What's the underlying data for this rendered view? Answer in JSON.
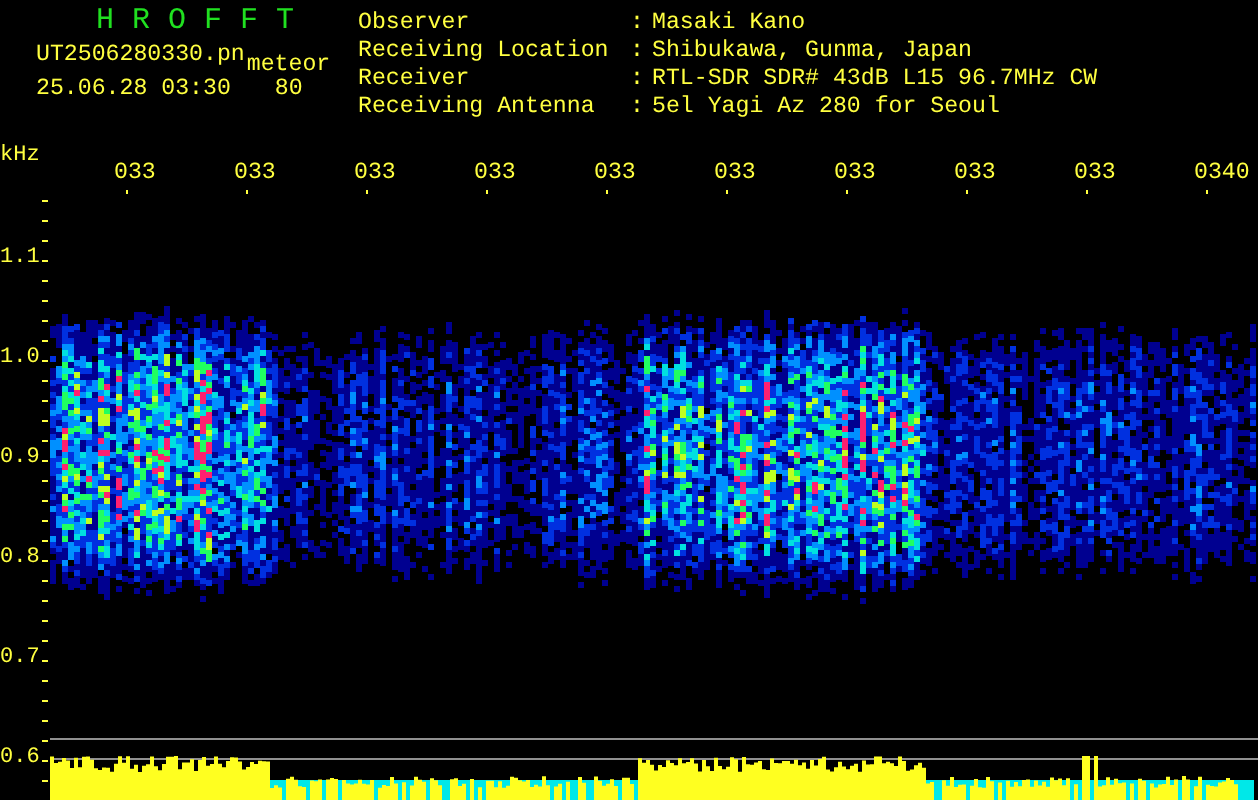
{
  "header": {
    "title": "H R O F F T",
    "filename": "UT2506280330.pn",
    "mode": "meteor",
    "datetime": "25.06.28 03:30",
    "count": "80"
  },
  "info": [
    {
      "label": "Observer",
      "separator": ":",
      "value": "Masaki Kano"
    },
    {
      "label": "Receiving Location",
      "separator": ":",
      "value": "Shibukawa, Gunma, Japan"
    },
    {
      "label": "Receiver",
      "separator": ":",
      "value": "RTL-SDR SDR# 43dB L15 96.7MHz CW"
    },
    {
      "label": "Receiving Antenna",
      "separator": ":",
      "value": "5el Yagi Az 280 for Seoul"
    }
  ],
  "spectrogram": {
    "unit": "kHz",
    "y_labels": [
      "1.1",
      "1.0",
      "0.9",
      "0.8",
      "0.7",
      "0.6"
    ],
    "time_labels": [
      "033",
      "033",
      "033",
      "033",
      "033",
      "033",
      "033",
      "033",
      "033",
      "0340"
    ]
  }
}
